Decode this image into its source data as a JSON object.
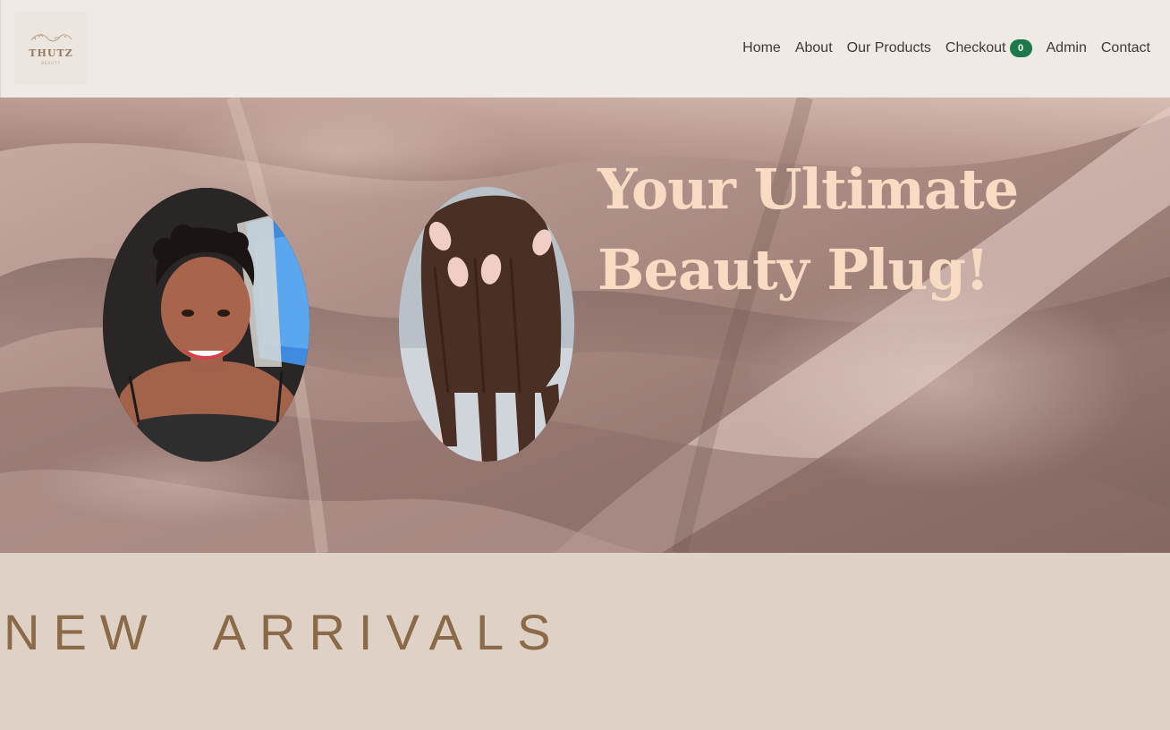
{
  "brand": {
    "logo_text": "THUTZ",
    "logo_subtext": "BEAUTY"
  },
  "nav": {
    "items": [
      {
        "label": "Home"
      },
      {
        "label": "About"
      },
      {
        "label": "Our Products"
      },
      {
        "label": "Checkout",
        "badge": "0"
      },
      {
        "label": "Admin"
      },
      {
        "label": "Contact"
      }
    ]
  },
  "hero": {
    "title_line1": "Your Ultimate",
    "title_line2": "Beauty Plug!"
  },
  "sections": {
    "new_arrivals_title": "NEW  ARRIVALS"
  },
  "colors": {
    "hero_title": "#f7dbc3",
    "arrivals_title": "#8a6a48",
    "cart_badge": "#1c7a4a",
    "header_bg": "#efeae5",
    "arrivals_bg": "#e0d1c6"
  }
}
